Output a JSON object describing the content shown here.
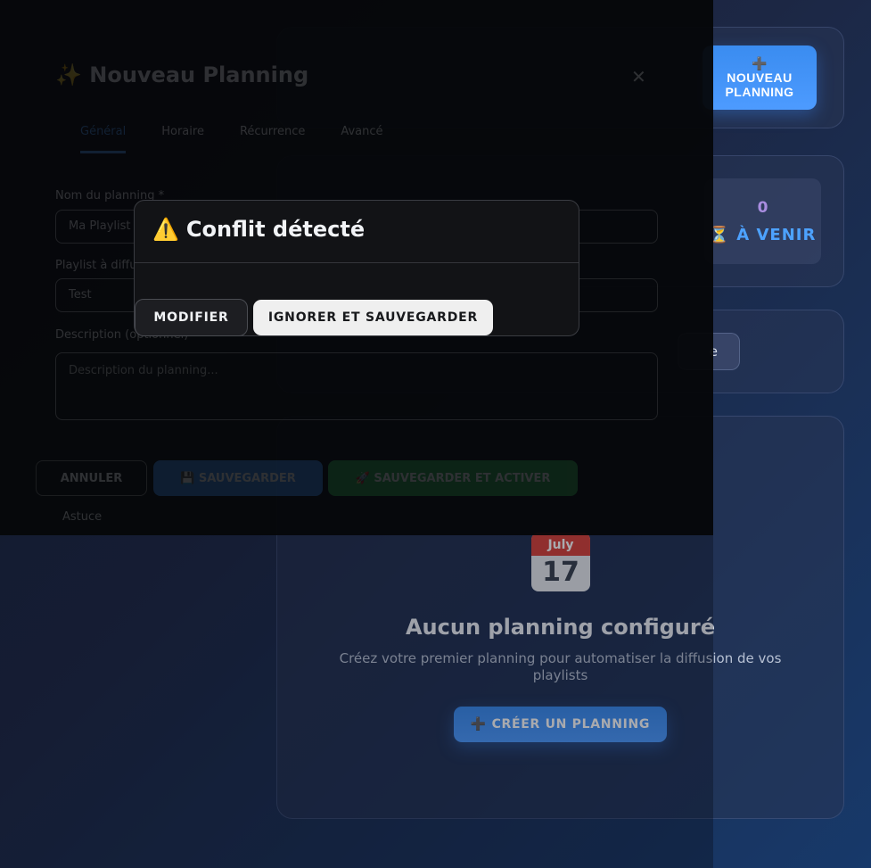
{
  "header": {
    "new_planning_icon": "➕",
    "new_planning_label": "NOUVEAU PLANNING"
  },
  "stats": {
    "upcoming_value": "0",
    "upcoming_label": "⏳ À VENIR"
  },
  "filter": {
    "button_label": "e"
  },
  "empty_state": {
    "icon": "calendar-icon",
    "calendar_month": "July",
    "calendar_day": "17",
    "title": "Aucun planning configuré",
    "subtitle": "Créez votre premier planning pour automatiser la diffusion de vos playlists",
    "create_button": "➕ CRÉER UN PLANNING"
  },
  "new_planning_modal": {
    "title": "✨ Nouveau Planning",
    "close": "✕",
    "tabs": [
      "Général",
      "Horaire",
      "Récurrence",
      "Avancé"
    ],
    "name_label": "Nom du planning *",
    "name_value": "Ma Playlist",
    "playlist_label": "Playlist à diffuser *",
    "playlist_value": "Test",
    "description_label": "Description (optionnel)",
    "description_placeholder": "Description du planning...",
    "cancel_button": "ANNULER",
    "save_button": "💾 SAUVEGARDER",
    "save_activate_button": "🚀 SAUVEGARDER ET ACTIVER",
    "footer_note": "Astuce"
  },
  "conflict_dialog": {
    "icon": "⚠️",
    "title": "Conflit détecté",
    "modify_button": "MODIFIER",
    "ignore_button": "IGNORER ET SAUVEGARDER"
  },
  "colors": {
    "accent": "#4d9bff",
    "dialog_bg": "#121316",
    "ignore_button_bg": "#efefef"
  }
}
